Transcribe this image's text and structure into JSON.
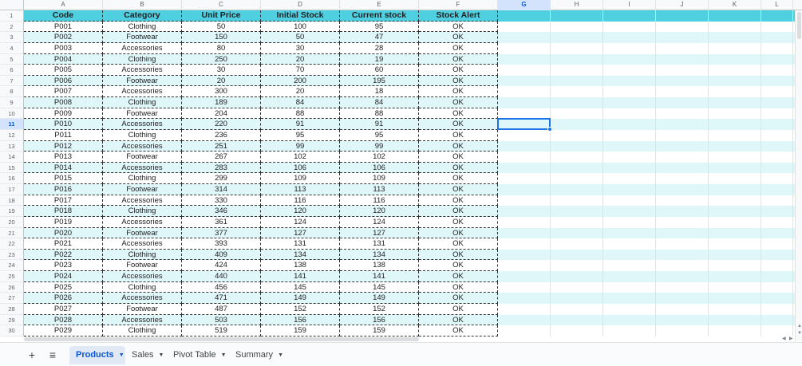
{
  "columns": [
    "A",
    "B",
    "C",
    "D",
    "E",
    "F",
    "G",
    "H",
    "I",
    "J",
    "K",
    "L"
  ],
  "selected_column": "G",
  "selected_row": "11",
  "header_row": [
    "Code",
    "Category",
    "Unit Price",
    "Initial Stock",
    "Current stock",
    "Stock Alert"
  ],
  "rows": [
    [
      "P001",
      "Clothing",
      "50",
      "100",
      "95",
      "OK"
    ],
    [
      "P002",
      "Footwear",
      "150",
      "50",
      "47",
      "OK"
    ],
    [
      "P003",
      "Accessories",
      "80",
      "30",
      "28",
      "OK"
    ],
    [
      "P004",
      "Clothing",
      "250",
      "20",
      "19",
      "OK"
    ],
    [
      "P005",
      "Accessories",
      "30",
      "70",
      "60",
      "OK"
    ],
    [
      "P006",
      "Footwear",
      "20",
      "200",
      "195",
      "OK"
    ],
    [
      "P007",
      "Accessories",
      "300",
      "20",
      "18",
      "OK"
    ],
    [
      "P008",
      "Clothing",
      "189",
      "84",
      "84",
      "OK"
    ],
    [
      "P009",
      "Footwear",
      "204",
      "88",
      "88",
      "OK"
    ],
    [
      "P010",
      "Accessories",
      "220",
      "91",
      "91",
      "OK"
    ],
    [
      "P011",
      "Clothing",
      "236",
      "95",
      "95",
      "OK"
    ],
    [
      "P012",
      "Accessories",
      "251",
      "99",
      "99",
      "OK"
    ],
    [
      "P013",
      "Footwear",
      "267",
      "102",
      "102",
      "OK"
    ],
    [
      "P014",
      "Accessories",
      "283",
      "106",
      "106",
      "OK"
    ],
    [
      "P015",
      "Clothing",
      "299",
      "109",
      "109",
      "OK"
    ],
    [
      "P016",
      "Footwear",
      "314",
      "113",
      "113",
      "OK"
    ],
    [
      "P017",
      "Accessories",
      "330",
      "116",
      "116",
      "OK"
    ],
    [
      "P018",
      "Clothing",
      "346",
      "120",
      "120",
      "OK"
    ],
    [
      "P019",
      "Accessories",
      "361",
      "124",
      "124",
      "OK"
    ],
    [
      "P020",
      "Footwear",
      "377",
      "127",
      "127",
      "OK"
    ],
    [
      "P021",
      "Accessories",
      "393",
      "131",
      "131",
      "OK"
    ],
    [
      "P022",
      "Clothing",
      "409",
      "134",
      "134",
      "OK"
    ],
    [
      "P023",
      "Footwear",
      "424",
      "138",
      "138",
      "OK"
    ],
    [
      "P024",
      "Accessories",
      "440",
      "141",
      "141",
      "OK"
    ],
    [
      "P025",
      "Clothing",
      "456",
      "145",
      "145",
      "OK"
    ],
    [
      "P026",
      "Accessories",
      "471",
      "149",
      "149",
      "OK"
    ],
    [
      "P027",
      "Footwear",
      "487",
      "152",
      "152",
      "OK"
    ],
    [
      "P028",
      "Accessories",
      "503",
      "156",
      "156",
      "OK"
    ],
    [
      "P029",
      "Clothing",
      "519",
      "159",
      "159",
      "OK"
    ]
  ],
  "tabs": [
    {
      "label": "Products",
      "active": true
    },
    {
      "label": "Sales",
      "active": false
    },
    {
      "label": "Pivot Table",
      "active": false
    },
    {
      "label": "Summary",
      "active": false
    }
  ],
  "toolbar": {
    "add_sheet_icon": "plus-icon",
    "all_sheets_icon": "menu-icon",
    "add_symbol": "+",
    "menu_symbol": "≡"
  },
  "colors": {
    "header_fill": "#4fd0e0",
    "band_fill": "#e0f7f9",
    "selection": "#1a73e8"
  }
}
